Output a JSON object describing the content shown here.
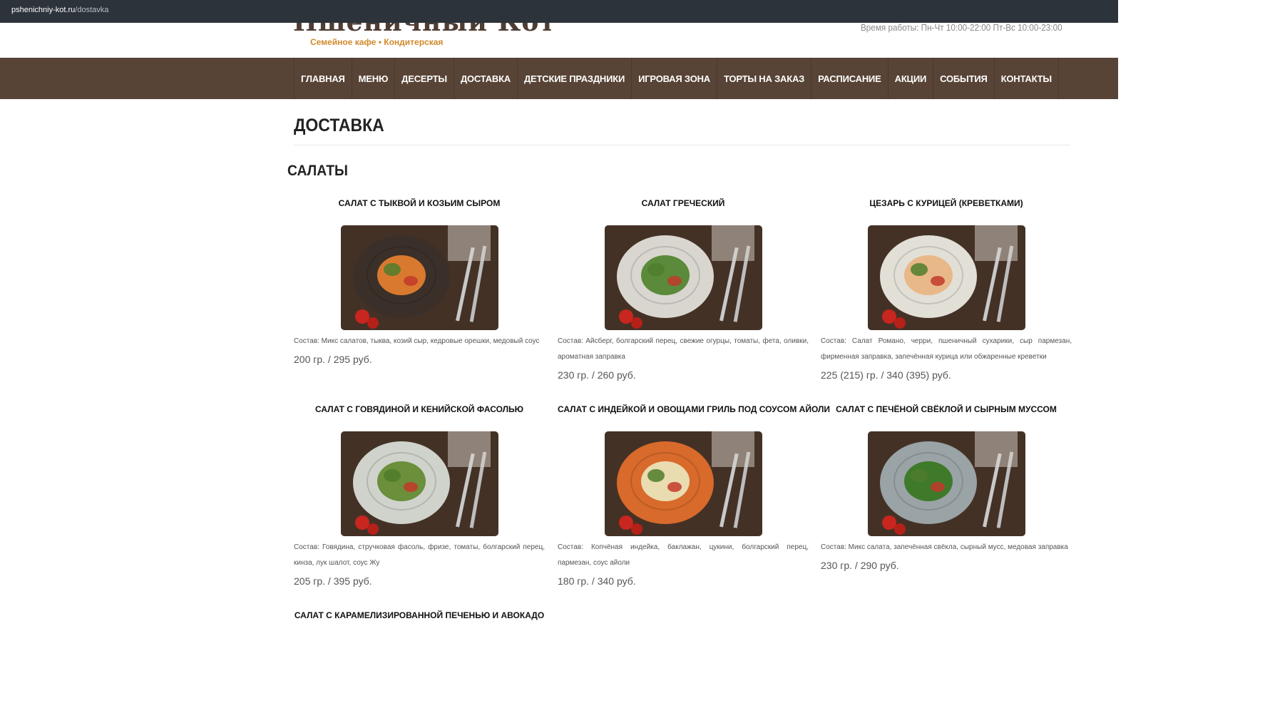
{
  "browser": {
    "url_domain": "pshenichniy-kot.ru",
    "url_path": "/dostavka"
  },
  "header": {
    "logo_text": "Пшеничный Кот",
    "tagline": "Семейное кафе • Кондитерская",
    "hours": "Время работы: Пн-Чт 10:00-22:00 Пт-Вс 10:00-23:00"
  },
  "nav": {
    "items": [
      "ГЛАВНАЯ",
      "МЕНЮ",
      "ДЕСЕРТЫ",
      "ДОСТАВКА",
      "ДЕТСКИЕ ПРАЗДНИКИ",
      "ИГРОВАЯ ЗОНА",
      "ТОРТЫ НА ЗАКАЗ",
      "РАСПИСАНИЕ",
      "АКЦИИ",
      "СОБЫТИЯ",
      "КОНТАКТЫ"
    ]
  },
  "page": {
    "title": "ДОСТАВКА",
    "section": "САЛАТЫ"
  },
  "products": [
    {
      "name": "САЛАТ С ТЫКВОЙ И КОЗЬИМ СЫРОМ",
      "description": "Состав: Микс салатов, тыква, козий сыр, кедровые орешки, медовый соус",
      "price": "200 гр. / 295 руб.",
      "plate_color": "#3b3029",
      "food_color": "#d9792f"
    },
    {
      "name": "САЛАТ ГРЕЧЕСКИЙ",
      "description": "Состав: Айсберг, болгарский перец, свежие огурцы, томаты, фета, оливки, ароматная заправка",
      "price": "230 гр. / 260 руб.",
      "plate_color": "#d8d6cf",
      "food_color": "#5a8a3a"
    },
    {
      "name": "ЦЕЗАРЬ С КУРИЦЕЙ (КРЕВЕТКАМИ)",
      "description": "Состав: Салат Романо, черри, пшеничный сухарики, сыр пармезан, фирменная заправка, запечённая курица или обжаренные креветки",
      "price": "225 (215) гр. / 340 (395) руб.",
      "plate_color": "#e2dfd7",
      "food_color": "#e8b889"
    },
    {
      "name": "САЛАТ С ГОВЯДИНОЙ И КЕНИЙСКОЙ ФАСОЛЬЮ",
      "description": "Состав: Говядина, стручковая фасоль, фризе, томаты, болгарский перец, кинза, лук шалот, соус Жу",
      "price": "205 гр. / 395 руб.",
      "plate_color": "#cfd3cc",
      "food_color": "#6b8f3b"
    },
    {
      "name": "САЛАТ С ИНДЕЙКОЙ И ОВОЩАМИ ГРИЛЬ ПОД СОУСОМ АЙОЛИ",
      "description": "Состав: Копчёная индейка, баклажан, цукини, болгарский перец, пармезан, соус айоли",
      "price": "180 гр. / 340 руб.",
      "plate_color": "#d86a2b",
      "food_color": "#e9dcb0"
    },
    {
      "name": "САЛАТ С ПЕЧЁНОЙ СВЁКЛОЙ И СЫРНЫМ МУССОМ",
      "description": "Состав: Микс салата, запечённая свёкла, сырный мусс, медовая заправка",
      "price": "230 гр. / 290 руб.",
      "plate_color": "#9aa3a6",
      "food_color": "#3e7a2a"
    }
  ],
  "next_product": {
    "name": "САЛАТ С КАРАМЕЛИЗИРОВАННОЙ ПЕЧЕНЬЮ И АВОКАДО"
  },
  "colors": {
    "nav_bg": "#584436",
    "tagline": "#d18a2a",
    "logo": "#4e3d34"
  }
}
